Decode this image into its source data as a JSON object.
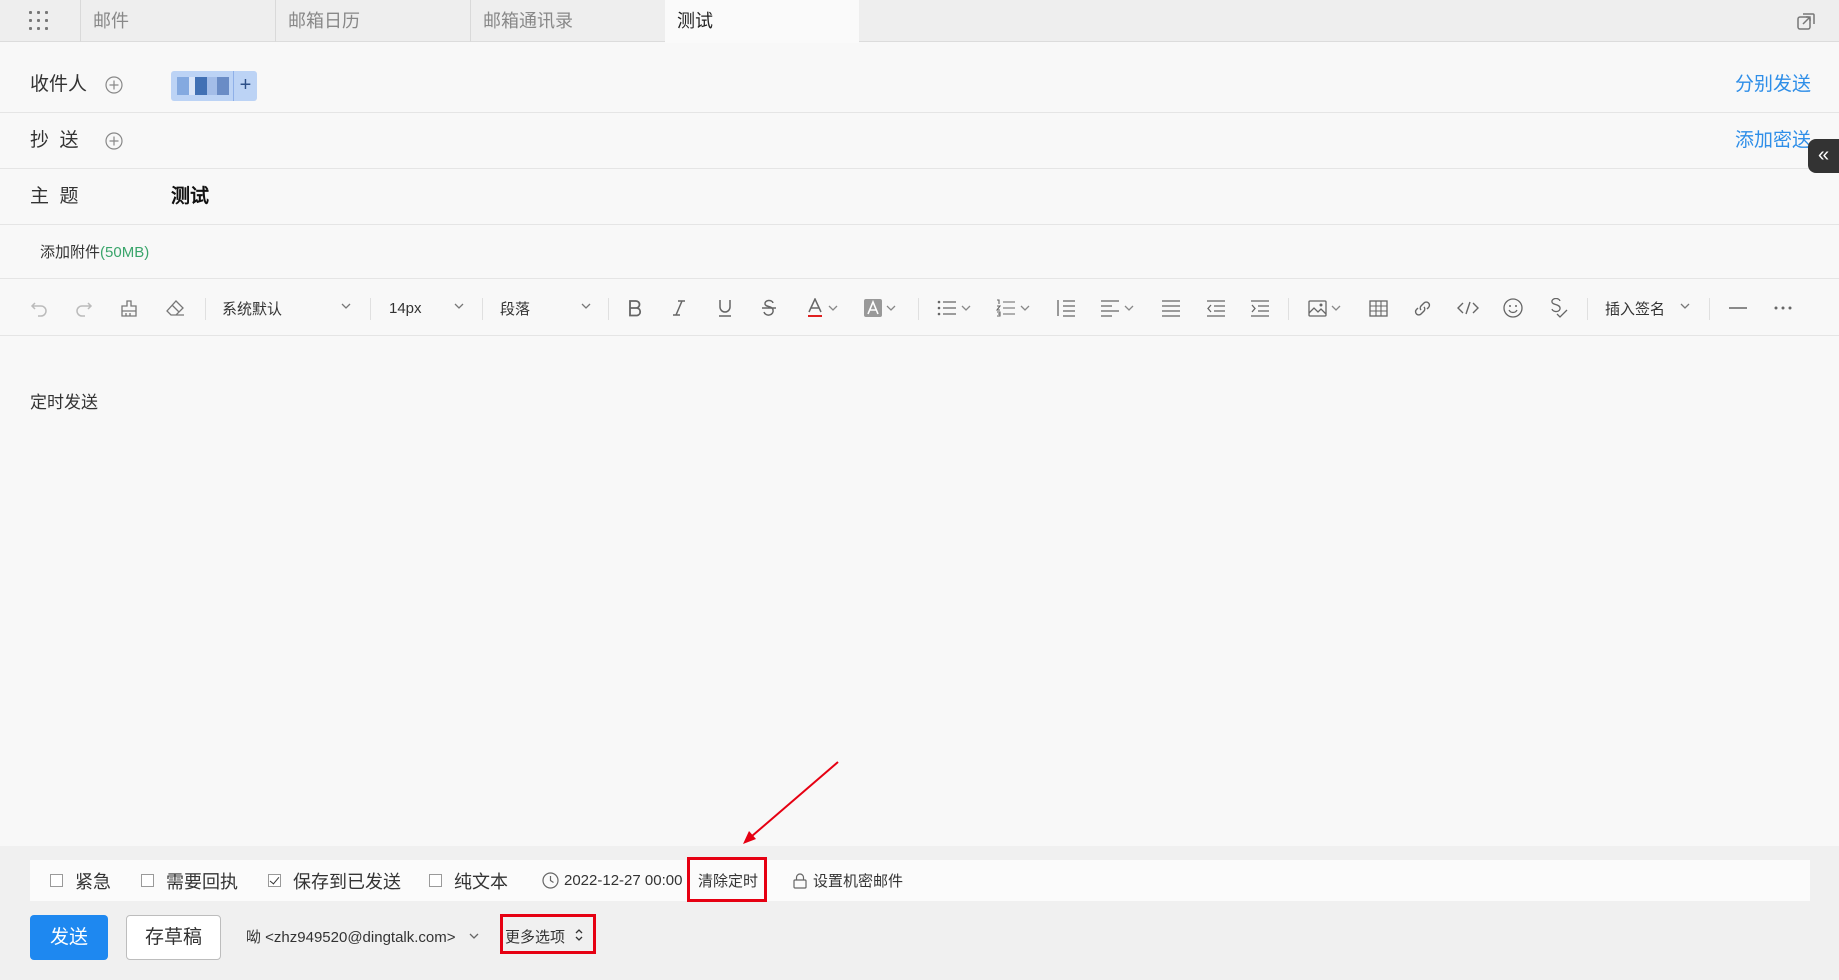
{
  "tabs": [
    {
      "label": "邮件"
    },
    {
      "label": "邮箱日历"
    },
    {
      "label": "邮箱通讯录"
    },
    {
      "label": "测试"
    }
  ],
  "compose": {
    "to_label": "收件人",
    "cc_label": "抄  送",
    "subject_label": "主  题",
    "subject_value": "测试",
    "send_separately": "分别发送",
    "add_bcc": "添加密送",
    "attach_label": "添加附件",
    "attach_size": "(50MB)"
  },
  "toolbar": {
    "font_family": "系统默认",
    "font_size": "14px",
    "paragraph": "段落",
    "signature": "插入签名"
  },
  "body": {
    "text": "定时发送"
  },
  "options": {
    "urgent": "紧急",
    "receipt": "需要回执",
    "save_sent": "保存到已发送",
    "plain_text": "纯文本",
    "scheduled_time": "2022-12-27 00:00",
    "clear_timer": "清除定时",
    "secure_mail": "设置机密邮件"
  },
  "actions": {
    "send": "发送",
    "save_draft": "存草稿",
    "sender": "呦 <zhz949520@dingtalk.com>",
    "more_options": "更多选项"
  },
  "colors": {
    "accent": "#1e88f0",
    "link": "#2e8ee8",
    "annotation": "#e60012"
  }
}
